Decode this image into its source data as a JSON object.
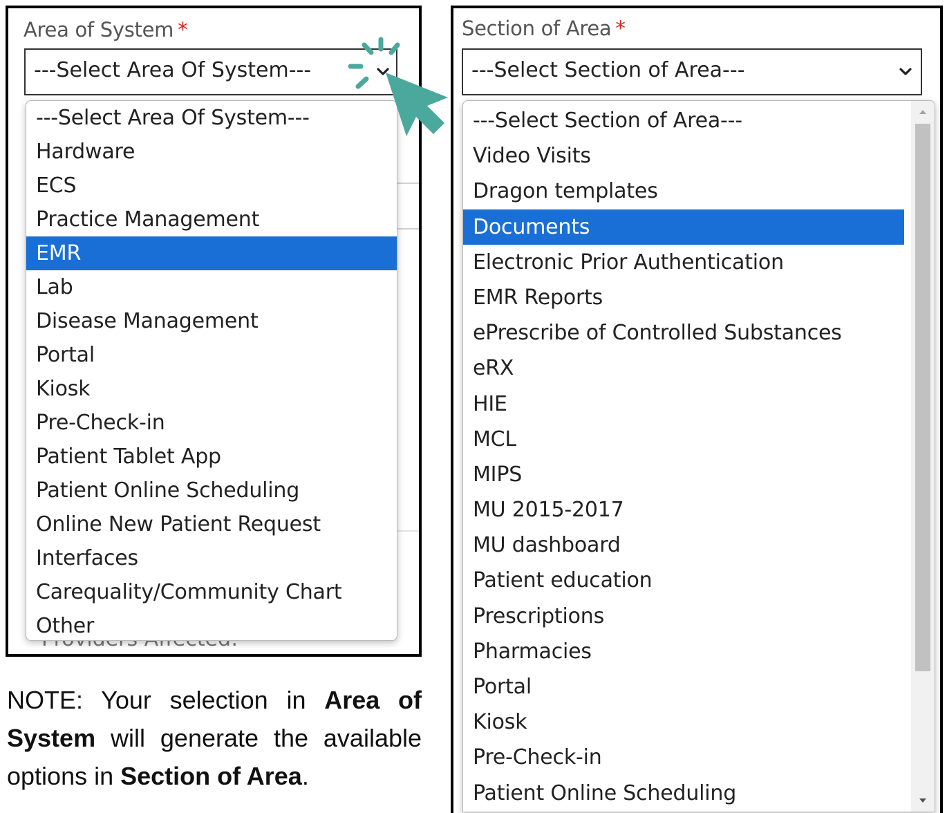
{
  "colors": {
    "selected_bg": "#1a6fd6",
    "required": "#d9241c",
    "cursor": "#4ba89c"
  },
  "area_of_system": {
    "label": "Area of System",
    "required_mark": "*",
    "selected_value": "---Select Area Of System---",
    "chevron_icon": "chevron-down-icon",
    "highlighted_index": 4,
    "options": [
      "---Select Area Of System---",
      "Hardware",
      "ECS",
      "Practice Management",
      "EMR",
      "Lab",
      "Disease Management",
      "Portal",
      "Kiosk",
      "Pre-Check-in",
      "Patient Tablet App",
      "Patient Online Scheduling",
      "Online New Patient Request",
      "Interfaces",
      "Carequality/Community Chart",
      "Other"
    ],
    "background_label": "Providers Affected:"
  },
  "section_of_area": {
    "label": "Section of Area",
    "required_mark": "*",
    "selected_value": "---Select Section of Area---",
    "chevron_icon": "chevron-down-icon",
    "highlighted_index": 3,
    "options": [
      "---Select Section of Area---",
      "Video Visits",
      "Dragon templates",
      "Documents",
      "Electronic Prior Authentication",
      "EMR Reports",
      "ePrescribe of Controlled Substances",
      "eRX",
      "HIE",
      "MCL",
      "MIPS",
      "MU 2015-2017",
      "MU dashboard",
      "Patient education",
      "Prescriptions",
      "Pharmacies",
      "Portal",
      "Kiosk",
      "Pre-Check-in",
      "Patient Online Scheduling"
    ]
  },
  "note": {
    "prefix": "NOTE: Your selection in ",
    "bold1": "Area of System",
    "middle": " will generate the available options in ",
    "bold2": "Section of Area",
    "suffix": "."
  },
  "cursor_icon": "click-cursor-icon"
}
